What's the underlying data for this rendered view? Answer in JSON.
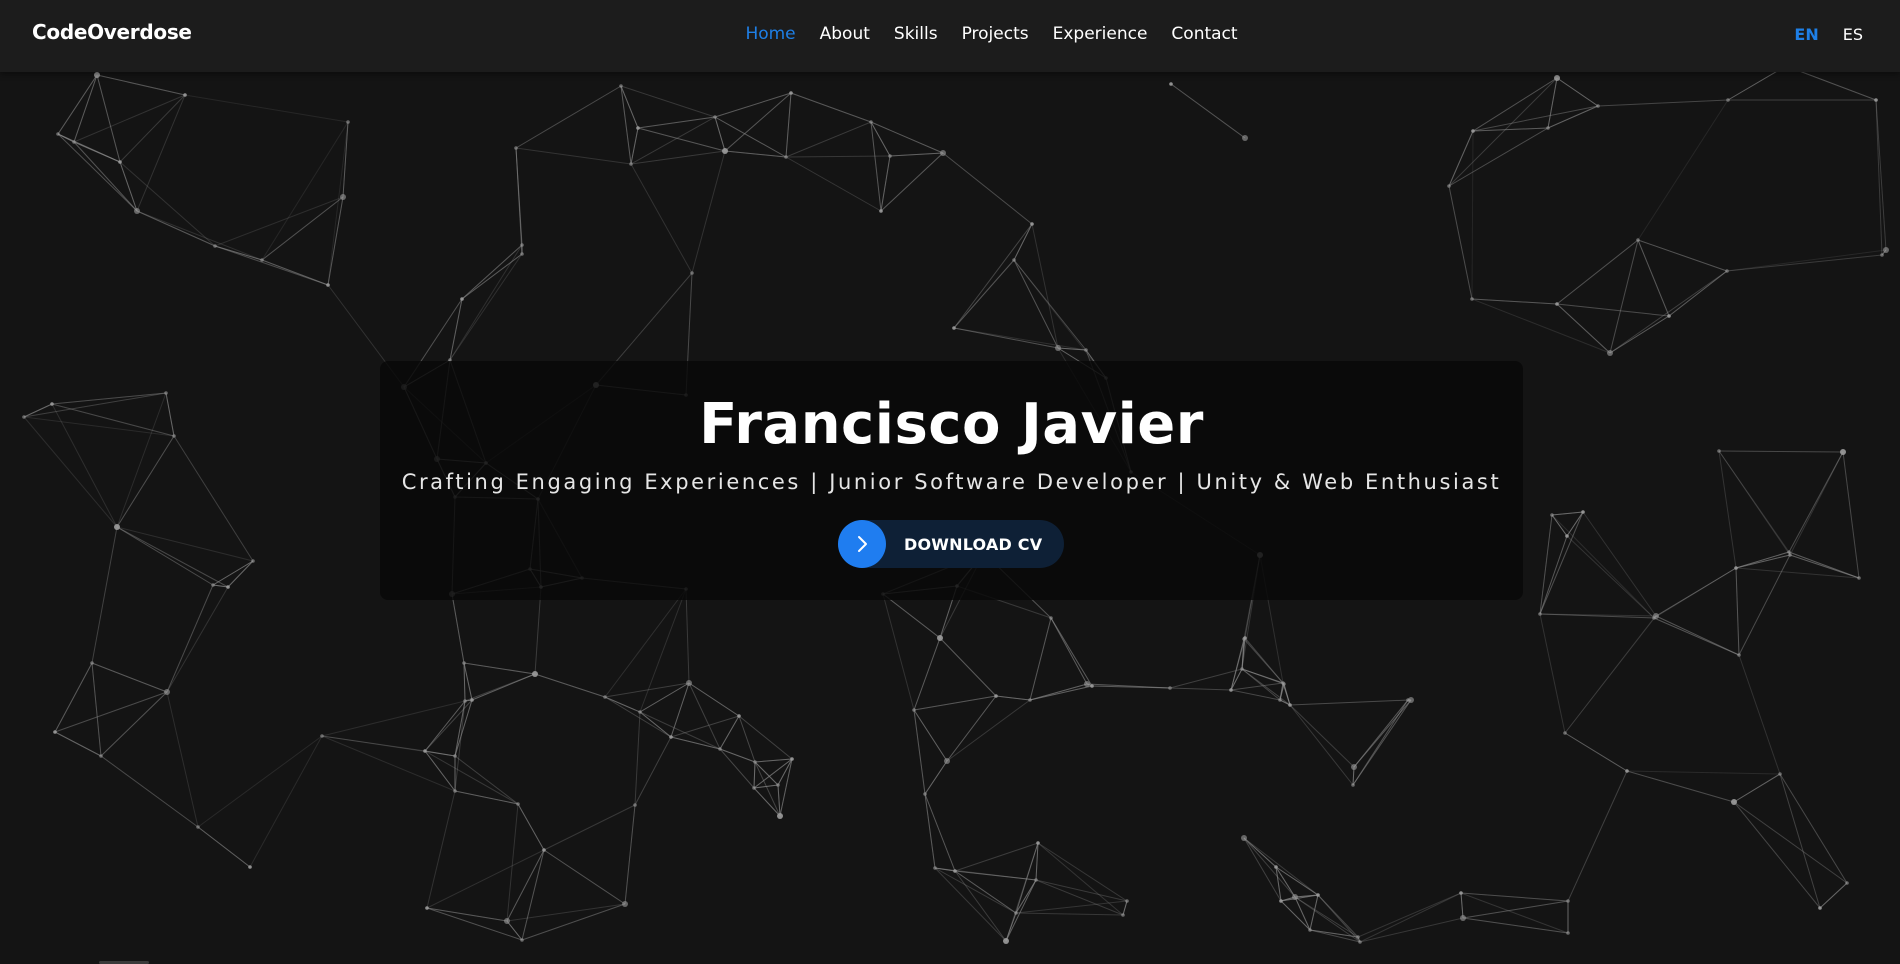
{
  "brand": "CodeOverdose",
  "nav": {
    "items": [
      "Home",
      "About",
      "Skills",
      "Projects",
      "Experience",
      "Contact"
    ],
    "active": "Home"
  },
  "languages": {
    "options": [
      "EN",
      "ES"
    ],
    "active": "EN"
  },
  "hero": {
    "name": "Francisco Javier",
    "tagline": "Crafting Engaging Experiences | Junior Software Developer | Unity & Web Enthusiast",
    "cta_label": "DOWNLOAD CV",
    "cta_icon": "chevron-right-icon"
  },
  "colors": {
    "accent": "#1e7fe6",
    "background": "#141414",
    "navbar": "#1c1c1c",
    "button_bg": "#0e2036",
    "button_icon_bg": "#1f7df0"
  },
  "background_effect": "particle-network"
}
